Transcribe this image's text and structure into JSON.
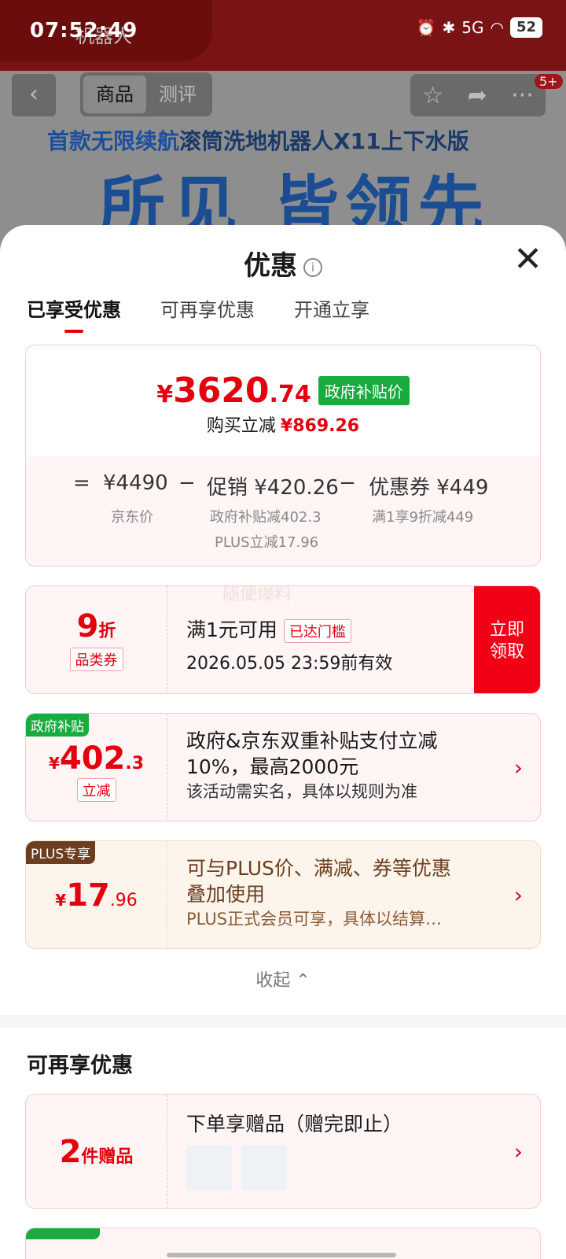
{
  "status_bar": {
    "time": "07:52:49",
    "network": "5G",
    "battery": "52"
  },
  "background": {
    "tab_title": "机器人",
    "segments": [
      "商品",
      "测评"
    ],
    "badge": "5+",
    "banner_blue": "首款无限续航",
    "banner_dark": "滚筒洗地机器人X11上下水版",
    "banner_big": "所见 皆领先"
  },
  "sheet": {
    "title": "优惠",
    "tabs": [
      "已享受优惠",
      "可再享优惠",
      "开通立享"
    ],
    "summary": {
      "price_yen": "¥",
      "price_int": "3620",
      "price_dec": ".74",
      "price_tag": "政府补贴价",
      "reduce_label": "购买立减",
      "reduce_value": "¥869.26",
      "eq": "=",
      "jd_price": "¥4490",
      "jd_label": "京东价",
      "minus1": "−",
      "promo": "促销 ¥420.26",
      "promo_sub1": "政府补贴减402.3",
      "promo_sub2": "PLUS立减17.96",
      "minus2": "−",
      "coupon": "优惠券 ¥449",
      "coupon_sub": "满1享9折减449"
    },
    "watermark": "随便爆料",
    "coupon1": {
      "value": "9",
      "unit": "折",
      "type_tag": "品类券",
      "title": "满1元可用",
      "status_tag": "已达门槛",
      "expiry": "2026.05.05 23:59前有效",
      "claim_line1": "立即",
      "claim_line2": "领取"
    },
    "coupon2": {
      "corner": "政府补贴",
      "yen": "¥",
      "value_int": "402",
      "value_dec": ".3",
      "type_tag": "立减",
      "line1": "政府&京东双重补贴支付立减",
      "line2": "10%，最高2000元",
      "line3": "该活动需实名，具体以规则为准"
    },
    "coupon3": {
      "corner": "PLUS专享",
      "yen": "¥",
      "value_int": "17",
      "value_dec": ".96",
      "line1": "可与PLUS价、满减、券等优惠",
      "line2": "叠加使用",
      "line3": "PLUS正式会员可享，具体以结算…"
    },
    "collapse_label": "收起",
    "section_title": "可再享优惠",
    "gift": {
      "count": "2",
      "unit": "件赠品",
      "title": "下单享赠品（赠完即止）"
    },
    "colors": {
      "accent": "#e3000f",
      "green": "#1aab3f",
      "plus_brown": "#6b3e1f"
    }
  }
}
